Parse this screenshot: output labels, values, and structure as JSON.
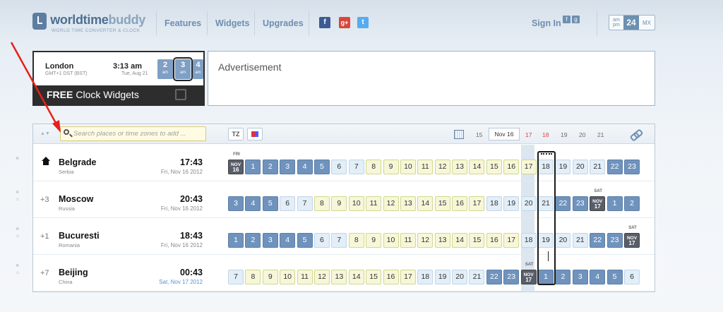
{
  "brand": {
    "name_a": "worldtime",
    "name_b": "buddy",
    "tagline": "WORLD TIME CONVERTER & CLOCK"
  },
  "nav": {
    "features": "Features",
    "widgets": "Widgets",
    "upgrades": "Upgrades",
    "signin": "Sign In"
  },
  "social": {
    "facebook": "f",
    "googleplus": "g+",
    "twitter": "t"
  },
  "format": {
    "am": "am",
    "pm": "pm",
    "h24": "24",
    "mx": "MX"
  },
  "widget": {
    "city": "London",
    "tz": "GMT+1 DST (BST)",
    "time": "3:13 am",
    "date": "Tue, Aug 21",
    "hours": [
      {
        "h": "2",
        "s": "am"
      },
      {
        "h": "3",
        "s": "am"
      },
      {
        "h": "4",
        "s": "am"
      }
    ],
    "free": "FREE",
    "clock_widgets": "Clock Widgets"
  },
  "ad": {
    "label": "Advertisement"
  },
  "toolbar": {
    "search_placeholder": "Search places or time zones to add ...",
    "tz": "TZ",
    "dates": [
      "15",
      "Nov 16",
      "17",
      "18",
      "19",
      "20",
      "21"
    ],
    "weekend_dates": [
      "17",
      "18"
    ]
  },
  "rows": [
    {
      "city": "Belgrade",
      "country": "Serbia",
      "offset": "",
      "time": "17:43",
      "date": "Fri, Nov 16 2012",
      "home": true,
      "cells": [
        {
          "v": "NOV|16",
          "k": "day",
          "above": "FRI"
        },
        {
          "v": "1",
          "k": "n"
        },
        {
          "v": "2",
          "k": "n"
        },
        {
          "v": "3",
          "k": "n"
        },
        {
          "v": "4",
          "k": "n"
        },
        {
          "v": "5",
          "k": "n"
        },
        {
          "v": "6",
          "k": "t"
        },
        {
          "v": "7",
          "k": "t"
        },
        {
          "v": "8",
          "k": "d"
        },
        {
          "v": "9",
          "k": "d"
        },
        {
          "v": "10",
          "k": "d"
        },
        {
          "v": "11",
          "k": "d"
        },
        {
          "v": "12",
          "k": "d"
        },
        {
          "v": "13",
          "k": "d"
        },
        {
          "v": "14",
          "k": "d"
        },
        {
          "v": "15",
          "k": "d"
        },
        {
          "v": "16",
          "k": "d"
        },
        {
          "v": "17",
          "k": "d"
        },
        {
          "v": "18",
          "k": "t"
        },
        {
          "v": "19",
          "k": "t"
        },
        {
          "v": "20",
          "k": "t"
        },
        {
          "v": "21",
          "k": "t"
        },
        {
          "v": "22",
          "k": "n"
        },
        {
          "v": "23",
          "k": "n"
        }
      ]
    },
    {
      "city": "Moscow",
      "country": "Russia",
      "offset": "+3",
      "time": "20:43",
      "date": "Fri, Nov 16 2012",
      "home": false,
      "cells": [
        {
          "v": "3",
          "k": "n"
        },
        {
          "v": "4",
          "k": "n"
        },
        {
          "v": "5",
          "k": "n"
        },
        {
          "v": "6",
          "k": "t"
        },
        {
          "v": "7",
          "k": "t"
        },
        {
          "v": "8",
          "k": "d"
        },
        {
          "v": "9",
          "k": "d"
        },
        {
          "v": "10",
          "k": "d"
        },
        {
          "v": "11",
          "k": "d"
        },
        {
          "v": "12",
          "k": "d"
        },
        {
          "v": "13",
          "k": "d"
        },
        {
          "v": "14",
          "k": "d"
        },
        {
          "v": "15",
          "k": "d"
        },
        {
          "v": "16",
          "k": "d"
        },
        {
          "v": "17",
          "k": "d"
        },
        {
          "v": "18",
          "k": "t"
        },
        {
          "v": "19",
          "k": "t"
        },
        {
          "v": "20",
          "k": "t"
        },
        {
          "v": "21",
          "k": "t"
        },
        {
          "v": "22",
          "k": "n"
        },
        {
          "v": "23",
          "k": "n"
        },
        {
          "v": "NOV|17",
          "k": "day",
          "above": "SAT"
        },
        {
          "v": "1",
          "k": "n"
        },
        {
          "v": "2",
          "k": "n"
        }
      ]
    },
    {
      "city": "Bucuresti",
      "country": "Romania",
      "offset": "+1",
      "time": "18:43",
      "date": "Fri, Nov 16 2012",
      "home": false,
      "cells": [
        {
          "v": "1",
          "k": "n"
        },
        {
          "v": "2",
          "k": "n"
        },
        {
          "v": "3",
          "k": "n"
        },
        {
          "v": "4",
          "k": "n"
        },
        {
          "v": "5",
          "k": "n"
        },
        {
          "v": "6",
          "k": "t"
        },
        {
          "v": "7",
          "k": "t"
        },
        {
          "v": "8",
          "k": "d"
        },
        {
          "v": "9",
          "k": "d"
        },
        {
          "v": "10",
          "k": "d"
        },
        {
          "v": "11",
          "k": "d"
        },
        {
          "v": "12",
          "k": "d"
        },
        {
          "v": "13",
          "k": "d"
        },
        {
          "v": "14",
          "k": "d"
        },
        {
          "v": "15",
          "k": "d"
        },
        {
          "v": "16",
          "k": "d"
        },
        {
          "v": "17",
          "k": "d"
        },
        {
          "v": "18",
          "k": "t"
        },
        {
          "v": "19",
          "k": "t"
        },
        {
          "v": "20",
          "k": "t"
        },
        {
          "v": "21",
          "k": "t"
        },
        {
          "v": "22",
          "k": "n"
        },
        {
          "v": "23",
          "k": "n"
        },
        {
          "v": "NOV|17",
          "k": "day",
          "above": "SAT"
        }
      ]
    },
    {
      "city": "Beijing",
      "country": "China",
      "offset": "+7",
      "time": "00:43",
      "date": "Sat, Nov 17 2012",
      "home": false,
      "cells": [
        {
          "v": "7",
          "k": "t"
        },
        {
          "v": "8",
          "k": "d"
        },
        {
          "v": "9",
          "k": "d"
        },
        {
          "v": "10",
          "k": "d"
        },
        {
          "v": "11",
          "k": "d"
        },
        {
          "v": "12",
          "k": "d"
        },
        {
          "v": "13",
          "k": "d"
        },
        {
          "v": "14",
          "k": "d"
        },
        {
          "v": "15",
          "k": "d"
        },
        {
          "v": "16",
          "k": "d"
        },
        {
          "v": "17",
          "k": "d"
        },
        {
          "v": "18",
          "k": "t"
        },
        {
          "v": "19",
          "k": "t"
        },
        {
          "v": "20",
          "k": "t"
        },
        {
          "v": "21",
          "k": "t"
        },
        {
          "v": "22",
          "k": "n"
        },
        {
          "v": "23",
          "k": "n"
        },
        {
          "v": "NOV|17",
          "k": "day",
          "above": "SAT"
        },
        {
          "v": "1",
          "k": "n"
        },
        {
          "v": "2",
          "k": "n"
        },
        {
          "v": "3",
          "k": "n"
        },
        {
          "v": "4",
          "k": "n"
        },
        {
          "v": "5",
          "k": "n"
        },
        {
          "v": "6",
          "k": "t"
        }
      ]
    }
  ],
  "colors": {
    "night": "#6f93bd",
    "twilight": "#e2eef8",
    "day": "#f8f6d8",
    "date_cell": "#585e69",
    "annotation_arrow": "#e8201a"
  }
}
